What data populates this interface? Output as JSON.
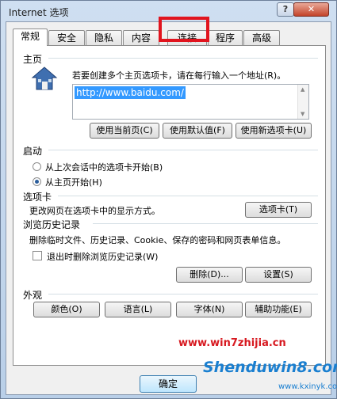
{
  "window": {
    "title": "Internet 选项",
    "help_label": "?",
    "close_label": "✕"
  },
  "tabs": [
    {
      "label": "常规",
      "active": true
    },
    {
      "label": "安全"
    },
    {
      "label": "隐私"
    },
    {
      "label": "内容"
    },
    {
      "label": "连接"
    },
    {
      "label": "程序"
    },
    {
      "label": "高级"
    }
  ],
  "homepage": {
    "heading": "主页",
    "description": "若要创建多个主页选项卡，请在每行输入一个地址(R)。",
    "url": "http://www.baidu.com/",
    "buttons": [
      "使用当前页(C)",
      "使用默认值(F)",
      "使用新选项卡(U)"
    ]
  },
  "startup": {
    "heading": "启动",
    "options": [
      {
        "label": "从上次会话中的选项卡开始(B)",
        "selected": false
      },
      {
        "label": "从主页开始(H)",
        "selected": true
      }
    ]
  },
  "tabs_section": {
    "heading": "选项卡",
    "description": "更改网页在选项卡中的显示方式。",
    "button": "选项卡(T)"
  },
  "history": {
    "heading": "浏览历史记录",
    "description": "删除临时文件、历史记录、Cookie、保存的密码和网页表单信息。",
    "checkbox_label": "退出时删除浏览历史记录(W)",
    "checkbox_checked": false,
    "delete_button": "删除(D)...",
    "settings_button": "设置(S)"
  },
  "appearance": {
    "heading": "外观",
    "buttons": [
      "颜色(O)",
      "语言(L)",
      "字体(N)",
      "辅助功能(E)"
    ]
  },
  "footer": {
    "ok": "确定"
  },
  "watermark": {
    "line1": "www.win7zhijia.cn",
    "line2": "Shenduwin8.com",
    "line3": "www.kxinyk.com"
  },
  "colors": {
    "highlight": "#e1141e",
    "selection": "#3399ff"
  }
}
